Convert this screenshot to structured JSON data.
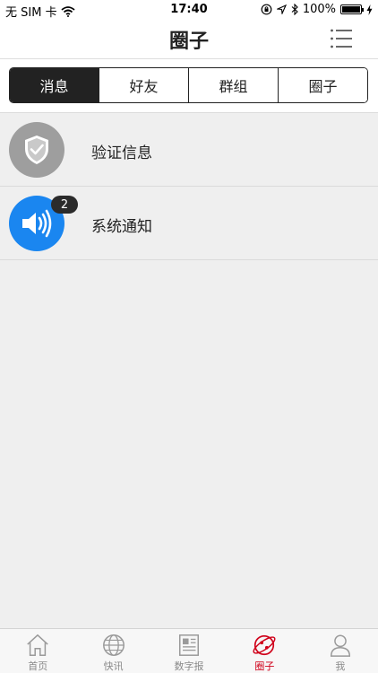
{
  "status_bar": {
    "carrier": "无 SIM 卡",
    "time": "17:40",
    "battery_text": "100%",
    "battery_level": 1.0,
    "icons": [
      "wifi-icon",
      "lock-rotation-icon",
      "location-icon",
      "bluetooth-icon",
      "battery-icon",
      "charging-icon"
    ]
  },
  "header": {
    "title": "圈子",
    "menu_icon": "list-menu-icon"
  },
  "segments": [
    {
      "label": "消息",
      "active": true
    },
    {
      "label": "好友",
      "active": false
    },
    {
      "label": "群组",
      "active": false
    },
    {
      "label": "圈子",
      "active": false
    }
  ],
  "messages": [
    {
      "label": "验证信息",
      "icon": "shield-check-icon",
      "color": "#9e9e9e",
      "badge": ""
    },
    {
      "label": "系统通知",
      "icon": "speaker-icon",
      "color": "#1a86f0",
      "badge": "2"
    }
  ],
  "tabbar": {
    "items": [
      {
        "label": "首页",
        "icon": "home-icon",
        "active": false
      },
      {
        "label": "快讯",
        "icon": "globe-icon",
        "active": false
      },
      {
        "label": "数字报",
        "icon": "newspaper-icon",
        "active": false
      },
      {
        "label": "圈子",
        "icon": "circle-planet-icon",
        "active": true
      },
      {
        "label": "我",
        "icon": "person-icon",
        "active": false
      }
    ]
  },
  "colors": {
    "active_tab": "#d0021b",
    "inactive_tab": "#8a8a8a",
    "segment_active_bg": "#222222",
    "page_bg": "#efefef"
  }
}
